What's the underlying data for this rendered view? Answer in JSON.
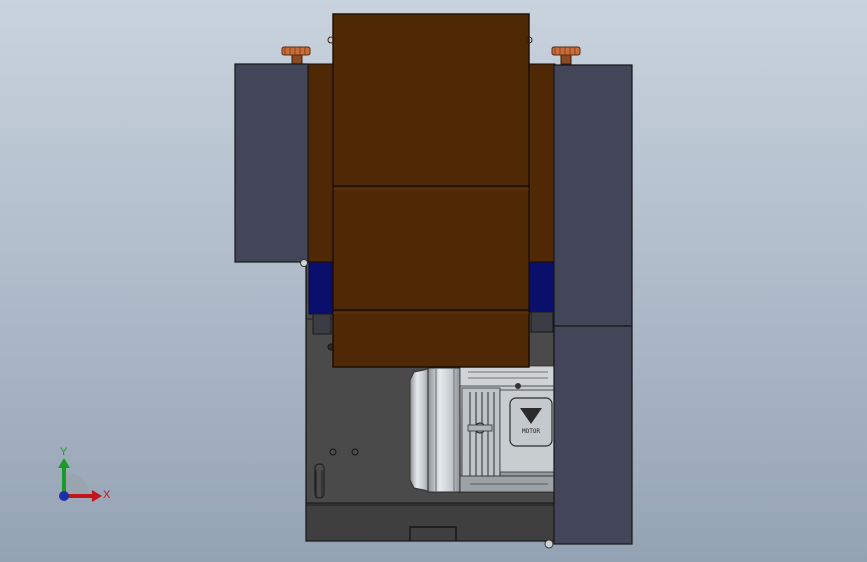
{
  "viewport": {
    "background_top": "#c9d3de",
    "background_bottom": "#94a3b4"
  },
  "model": {
    "colors": {
      "housing": "#4f2805",
      "housing_edge": "#1a0c02",
      "side_panel": "#434659",
      "side_panel_edge": "#15161c",
      "blue_band": "#0a0f6b",
      "base_frame": "#4a4a4a",
      "motor_metal": "#b9bec3",
      "motor_dark": "#2b2b2b",
      "knob": "#c96d3a"
    },
    "motor_nameplate_text": "MOTOR"
  },
  "triad": {
    "x_label": "X",
    "y_label": "Y",
    "x_color": "#c0161c",
    "y_color": "#1b9a2a",
    "z_color": "#1b2fa8"
  }
}
